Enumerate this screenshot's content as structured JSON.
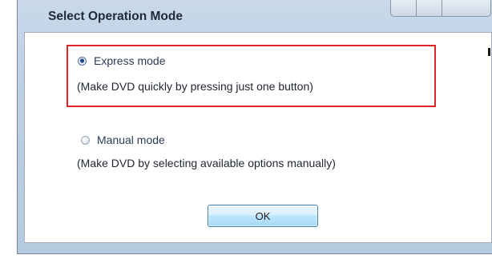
{
  "dialog": {
    "title": "Select Operation Mode"
  },
  "options": [
    {
      "label": "Express mode",
      "description": "(Make DVD quickly by pressing just one button)",
      "selected": true
    },
    {
      "label": "Manual mode",
      "description": "(Make DVD by selecting available options manually)",
      "selected": false
    }
  ],
  "buttons": {
    "ok_label": "OK"
  },
  "colors": {
    "highlight_border": "#e0262b",
    "dialog_frame": "#bdd0e4",
    "text": "#1f2530"
  }
}
